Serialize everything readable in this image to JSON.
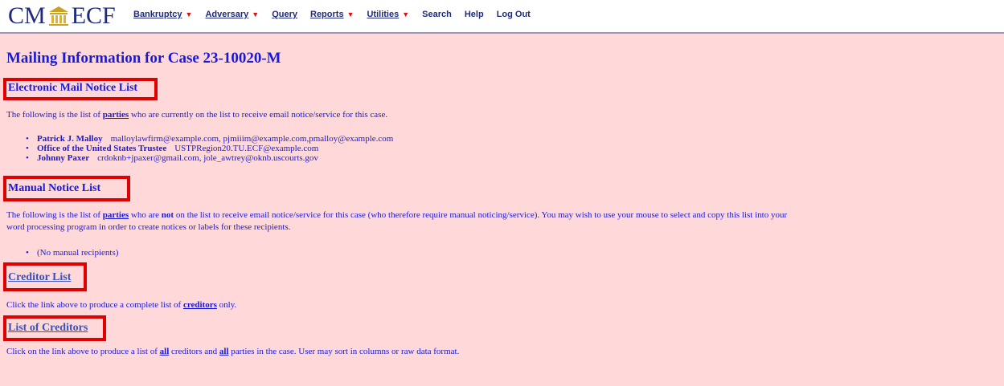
{
  "app": {
    "logo_left": "CM",
    "logo_right": "ECF"
  },
  "nav": {
    "items": [
      {
        "label": "Bankruptcy",
        "has_dropdown": true
      },
      {
        "label": "Adversary",
        "has_dropdown": true
      },
      {
        "label": "Query",
        "has_dropdown": false
      },
      {
        "label": "Reports",
        "has_dropdown": true
      },
      {
        "label": "Utilities",
        "has_dropdown": true
      },
      {
        "label": "Search",
        "has_dropdown": false
      },
      {
        "label": "Help",
        "has_dropdown": false
      },
      {
        "label": "Log Out",
        "has_dropdown": false
      }
    ]
  },
  "page": {
    "title": "Mailing Information for Case 23-10020-M"
  },
  "email_section": {
    "heading": "Electronic Mail Notice List",
    "intro_before": "The following is the list of",
    "intro_link": "parties",
    "intro_after": "who are currently on the list to receive email notice/service for this case.",
    "recipients": [
      {
        "name": "Patrick J. Malloy",
        "emails": "malloylawfirm@example.com, pjmiiim@example.com,pmalloy@example.com"
      },
      {
        "name": "Office of the United States Trustee",
        "emails": "USTPRegion20.TU.ECF@example.com"
      },
      {
        "name": "Johnny Paxer",
        "emails": "crdoknb+jpaxer@gmail.com, jole_awtrey@oknb.uscourts.gov"
      }
    ]
  },
  "manual_section": {
    "heading": "Manual Notice List",
    "intro_before": "The following is the list of",
    "intro_link": "parties",
    "intro_mid": "who are",
    "intro_not": "not",
    "intro_after": "on the list to receive email notice/service for this case (who therefore require manual noticing/service). You may wish to use your mouse to select and copy this list into your",
    "intro_line2": "word processing program in order to create notices or labels for these recipients.",
    "recipients": [
      "(No manual recipients)"
    ]
  },
  "creditor_section": {
    "heading": "Creditor List",
    "text_before": "Click the link above to produce a complete list of",
    "text_link": "creditors",
    "text_after": "only."
  },
  "list_of_creditors_section": {
    "heading": "List of Creditors",
    "text_before": "Click on the link above to produce a list of",
    "link_all_1": "all",
    "text_mid": "creditors and",
    "link_all_2": "all",
    "text_after": "parties in the case. User may sort in columns or raw data format."
  },
  "colors": {
    "background": "#ffd9d9",
    "text": "#1a1ad6",
    "highlight_box": "#e10000",
    "nav_caret": "#dd1111"
  }
}
